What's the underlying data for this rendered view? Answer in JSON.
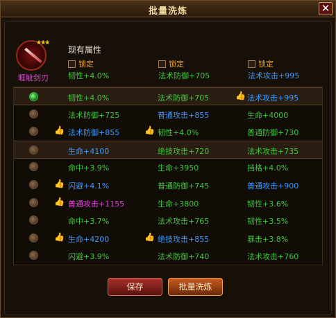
{
  "window": {
    "title": "批量洗炼",
    "close_label": "✕"
  },
  "item": {
    "name": "睚眦剑刃",
    "stars": "★★★",
    "icon": "sword-icon"
  },
  "current": {
    "label": "现有属性",
    "locks": [
      "锁定",
      "锁定",
      "锁定"
    ],
    "attrs": [
      {
        "text": "韧性+4.0%",
        "color": "green"
      },
      {
        "text": "法术防御+705",
        "color": "green"
      },
      {
        "text": "法术攻击+995",
        "color": "blue"
      }
    ]
  },
  "rows": [
    {
      "selected": true,
      "cells": [
        {
          "text": "韧性+4.0%",
          "color": "green",
          "thumb": false
        },
        {
          "text": "法术防御+705",
          "color": "green",
          "thumb": false
        },
        {
          "text": "法术攻击+995",
          "color": "blue",
          "thumb": true
        }
      ]
    },
    {
      "selected": false,
      "cells": [
        {
          "text": "法术防御+725",
          "color": "green",
          "thumb": false
        },
        {
          "text": "普通攻击+855",
          "color": "blue",
          "thumb": false
        },
        {
          "text": "生命+4000",
          "color": "green",
          "thumb": false
        }
      ]
    },
    {
      "selected": false,
      "cells": [
        {
          "text": "法术防御+855",
          "color": "blue",
          "thumb": true
        },
        {
          "text": "韧性+4.0%",
          "color": "green",
          "thumb": true
        },
        {
          "text": "普通防御+730",
          "color": "green",
          "thumb": false
        }
      ]
    },
    {
      "selected": false,
      "highlight": true,
      "cells": [
        {
          "text": "生命+4100",
          "color": "blue",
          "thumb": false
        },
        {
          "text": "绝技攻击+720",
          "color": "green",
          "thumb": false
        },
        {
          "text": "法术攻击+735",
          "color": "green",
          "thumb": false
        }
      ]
    },
    {
      "selected": false,
      "cells": [
        {
          "text": "命中+3.9%",
          "color": "green",
          "thumb": false
        },
        {
          "text": "生命+3950",
          "color": "green",
          "thumb": false
        },
        {
          "text": "挡格+4.0%",
          "color": "green",
          "thumb": false
        }
      ]
    },
    {
      "selected": false,
      "cells": [
        {
          "text": "闪避+4.1%",
          "color": "blue",
          "thumb": true
        },
        {
          "text": "普通防御+745",
          "color": "green",
          "thumb": false
        },
        {
          "text": "普通攻击+900",
          "color": "blue",
          "thumb": false
        }
      ]
    },
    {
      "selected": false,
      "cells": [
        {
          "text": "普通攻击+1155",
          "color": "pink",
          "thumb": true
        },
        {
          "text": "生命+3800",
          "color": "green",
          "thumb": false
        },
        {
          "text": "韧性+3.6%",
          "color": "green",
          "thumb": false
        }
      ]
    },
    {
      "selected": false,
      "cells": [
        {
          "text": "命中+3.7%",
          "color": "green",
          "thumb": false
        },
        {
          "text": "法术攻击+765",
          "color": "green",
          "thumb": false
        },
        {
          "text": "韧性+3.5%",
          "color": "green",
          "thumb": false
        }
      ]
    },
    {
      "selected": false,
      "cells": [
        {
          "text": "生命+4200",
          "color": "blue",
          "thumb": true
        },
        {
          "text": "绝技攻击+855",
          "color": "blue",
          "thumb": true
        },
        {
          "text": "暴击+3.8%",
          "color": "green",
          "thumb": false
        }
      ]
    },
    {
      "selected": false,
      "cells": [
        {
          "text": "闪避+3.9%",
          "color": "green",
          "thumb": false
        },
        {
          "text": "法术防御+740",
          "color": "green",
          "thumb": false
        },
        {
          "text": "法术攻击+760",
          "color": "green",
          "thumb": false
        }
      ]
    }
  ],
  "buttons": {
    "save": "保存",
    "batch": "批量洗炼"
  },
  "icons": {
    "thumb": "thumbs-up-icon",
    "radio": "radio-icon"
  }
}
